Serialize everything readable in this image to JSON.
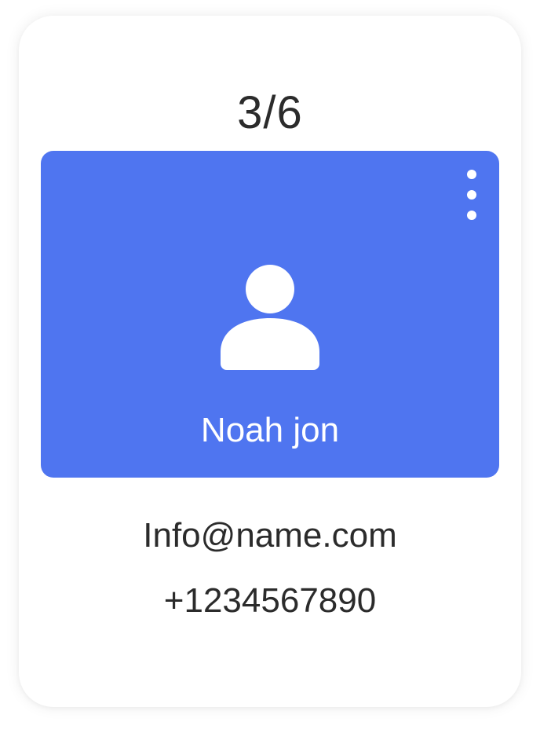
{
  "counter": {
    "text": "3/6"
  },
  "profile": {
    "name": "Noah jon",
    "email": "Info@name.com",
    "phone": "+1234567890",
    "avatar_icon": "user-icon",
    "menu_icon": "more-vertical-icon",
    "panel_color": "#4f75f0"
  }
}
